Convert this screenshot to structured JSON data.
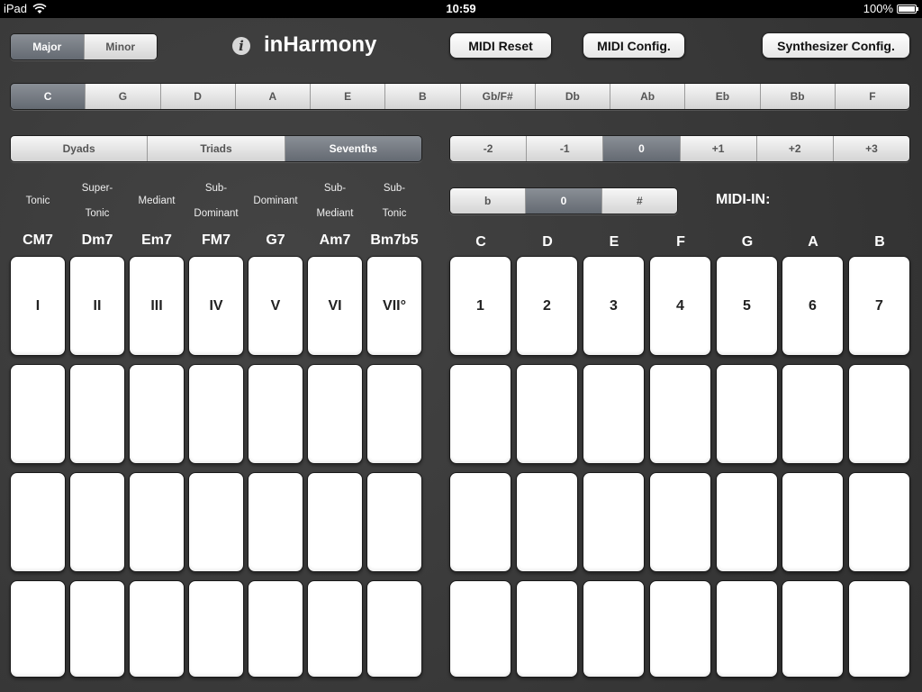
{
  "status": {
    "device": "iPad",
    "time": "10:59",
    "battery": "100%"
  },
  "app": {
    "title": "inHarmony"
  },
  "mode": {
    "options": [
      "Major",
      "Minor"
    ],
    "selected": "Major"
  },
  "buttons": {
    "midi_reset": "MIDI Reset",
    "midi_config": "MIDI Config.",
    "synth_config": "Synthesizer Config."
  },
  "keys": {
    "options": [
      "C",
      "G",
      "D",
      "A",
      "E",
      "B",
      "Gb/F#",
      "Db",
      "Ab",
      "Eb",
      "Bb",
      "F"
    ],
    "selected": "C"
  },
  "chord_type": {
    "options": [
      "Dyads",
      "Triads",
      "Sevenths"
    ],
    "selected": "Sevenths"
  },
  "transpose": {
    "options": [
      "-2",
      "-1",
      "0",
      "+1",
      "+2",
      "+3"
    ],
    "selected": "0"
  },
  "accidental": {
    "options": [
      "b",
      "0",
      "#"
    ],
    "selected": "0"
  },
  "midi_in_label": "MIDI-IN:",
  "functions": [
    [
      "Tonic"
    ],
    [
      "Super-",
      "Tonic"
    ],
    [
      "Mediant"
    ],
    [
      "Sub-",
      "Dominant"
    ],
    [
      "Dominant"
    ],
    [
      "Sub-",
      "Mediant"
    ],
    [
      "Sub-",
      "Tonic"
    ]
  ],
  "chords": [
    "CM7",
    "Dm7",
    "Em7",
    "FM7",
    "G7",
    "Am7",
    "Bm7b5"
  ],
  "degrees": [
    "I",
    "II",
    "III",
    "IV",
    "V",
    "VI",
    "VII°"
  ],
  "notes": [
    "C",
    "D",
    "E",
    "F",
    "G",
    "A",
    "B"
  ],
  "note_numbers": [
    "1",
    "2",
    "3",
    "4",
    "5",
    "6",
    "7"
  ]
}
